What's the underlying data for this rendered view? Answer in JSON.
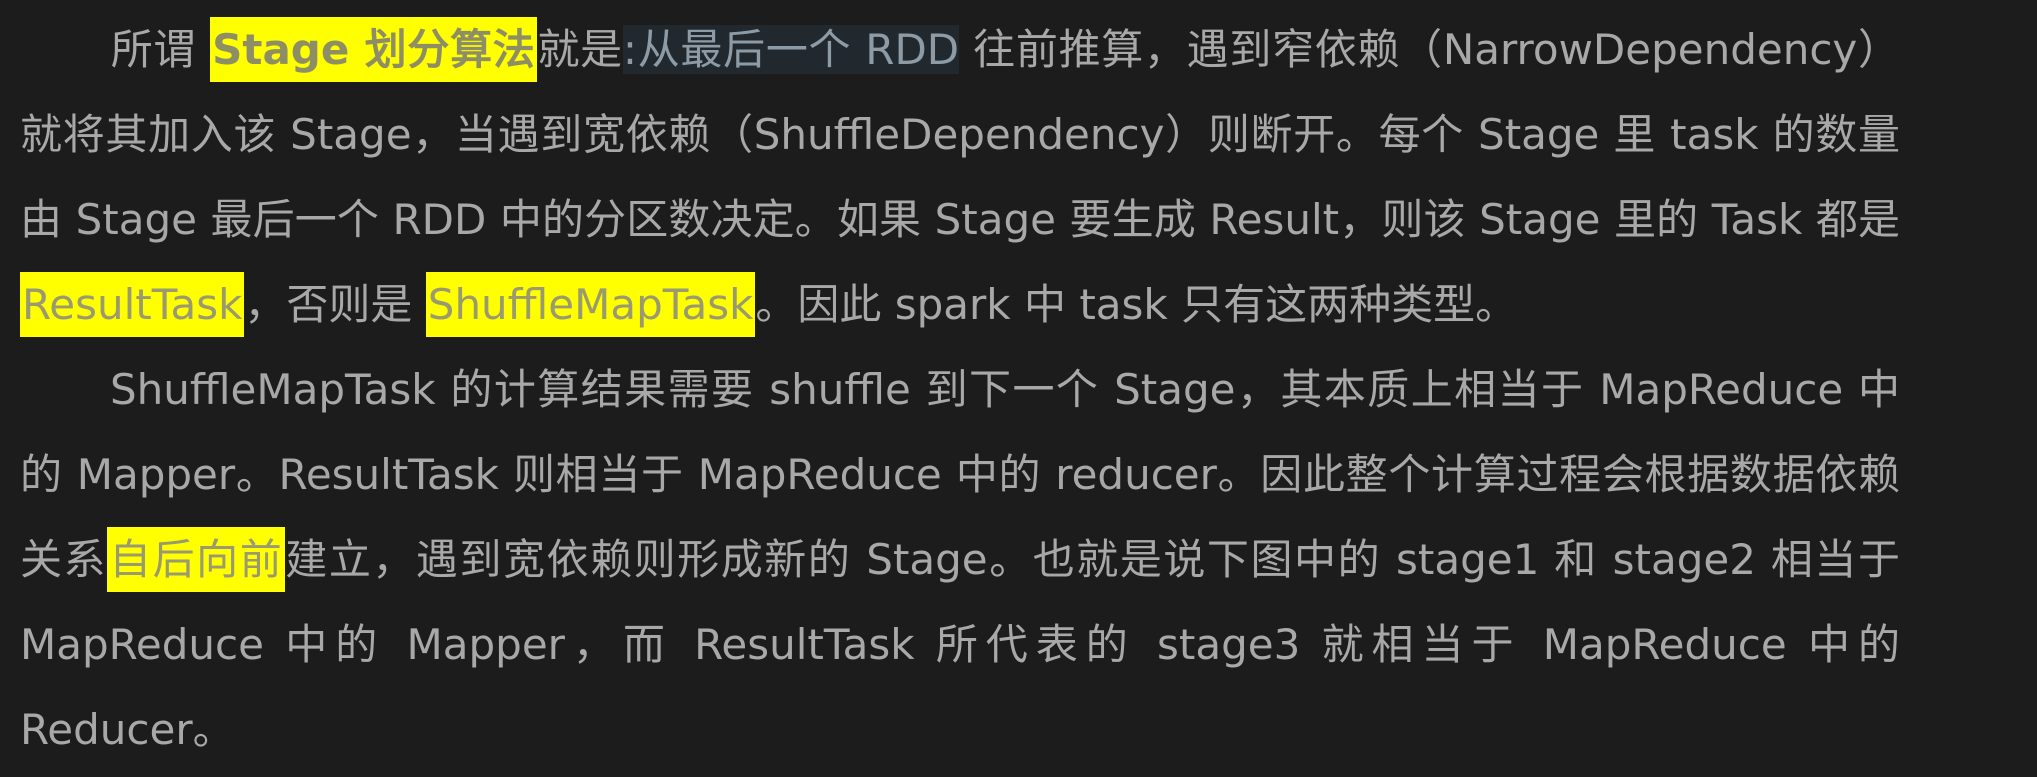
{
  "colors": {
    "background": "#1c1c1c",
    "text": "#a8a8a8",
    "highlight": "#ffff00",
    "highlight_text": "#9a9a70",
    "selection_bg": "#22292e",
    "selection_text": "#8c9ba6"
  },
  "para1": {
    "t1": "所谓 ",
    "h1": "Stage 划分算法",
    "t2": "就是",
    "s1": ":从最后一个 RDD",
    "t3": " 往前推算，遇到窄依赖（NarrowDependency）就将其加入该 Stage，当遇到宽依赖（ShuffleDependency）则断开。每个 Stage  里 task 的数量由 Stage 最后一个 RDD 中的分区数决定。如果 Stage 要生成 Result，则该 Stage 里的 Task 都是 ",
    "h2": "ResultTask",
    "t4": "，否则是 ",
    "h3": "ShuffleMapTask",
    "t5": "。因此 spark 中 task 只有这两种类型。"
  },
  "para2": {
    "t1": "ShuffleMapTask 的计算结果需要 shuffle 到下一个 Stage，其本质上相当于 MapReduce 中的 Mapper。ResultTask 则相当于 MapReduce 中的  reducer。因此整个计算过程会根据数据依赖关系",
    "h1": "自后向前",
    "t2": "建立，遇到宽依赖则形成新的 Stage。也就是说下图中的 stage1 和 stage2 相当于 MapReduce 中的 Mapper，而 ResultTask 所代表的 stage3 就相当于 MapReduce 中的 Reducer。"
  }
}
